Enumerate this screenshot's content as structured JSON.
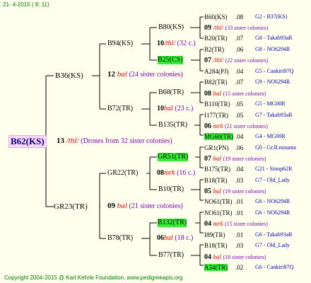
{
  "header": "21-  4-2015 (  8: 11)",
  "footer": "Copyright 2004-2015 @ Karl Kehrle Foundation.   www.pedigreeapis.org",
  "root": {
    "label": "B62(KS)",
    "num": "13",
    "mark": "/thl/",
    "note": "(Drones from 32 sister colonies)"
  },
  "gen1": [
    {
      "label": "B36(KS)"
    },
    {
      "label": "GR23(TR)"
    }
  ],
  "gen2": [
    {
      "label": "B94(KS)",
      "num": "12",
      "mark": "bal",
      "note": "(24 sister colonies)"
    },
    {
      "label": "B72(TR)"
    },
    {
      "label": "GR22(TR)",
      "num": "09",
      "mark": "bal",
      "note": "(21 sister colonies)"
    },
    {
      "label": "B78(TR)"
    }
  ],
  "gen3": [
    {
      "label": "B80(KS)",
      "num": "10",
      "mark": "/thl/",
      "note": "(32 c.)"
    },
    {
      "label": "B25(CS)"
    },
    {
      "label": "B68(TR)",
      "num": "10",
      "mark": "bal",
      "note": "(23 c.)"
    },
    {
      "label": "B135(TR)"
    },
    {
      "label": "GR51(TR)",
      "num": "08",
      "mark": "mrk",
      "note": "(16 c.)"
    },
    {
      "label": "B10(TR)"
    },
    {
      "label": "B132(TR)",
      "num": "06",
      "mark": "bal",
      "note": "(18 c.)"
    },
    {
      "label": "B77(TR)"
    }
  ],
  "gen4": [
    {
      "label": "B60(KS)",
      "yr": ".08",
      "tag": "G2 - B37(KS)"
    },
    {
      "num": "09",
      "mark": "/thl/",
      "note": "(33 sister colonies)"
    },
    {
      "label": "B20(TR)",
      "yr": ".07",
      "tag": "G8 - Takab93aR"
    },
    {
      "label": "B2(TR)",
      "yr": ".06",
      "tag": "G8 - NO6294R"
    },
    {
      "num": "07",
      "mark": "/thl/",
      "note": "(22 sister colonies)"
    },
    {
      "label": "A284(PJ)",
      "yr": ".04",
      "tag": "G5 - Cankiri97Q"
    },
    {
      "label": "B82(TR)",
      "yr": ".07",
      "tag": "G9 - NO6294R"
    },
    {
      "num": "08",
      "mark": "bal",
      "note": "(15 sister colonies)"
    },
    {
      "label": "B110(TR)",
      "yr": ".05",
      "tag": "G5 - MG00R"
    },
    {
      "label": "I177(TR)",
      "yr": ".05",
      "tag": "G7 - Takab93aR"
    },
    {
      "num": "06",
      "mark": "mrk",
      "note": "(21 sister colonies)"
    },
    {
      "label": "MG60(TR)",
      "yr": ".04",
      "tag": "G4 - MG00R"
    },
    {
      "label": "GR1(PN)",
      "yr": ".06",
      "tag": "G0 - Gr.R.mounta"
    },
    {
      "num": "07",
      "mark": "bal",
      "note": "(19 sister colonies)"
    },
    {
      "label": "B175(TR)",
      "yr": ".04",
      "tag": "G21 - Sinop62R"
    },
    {
      "label": "B18(TR)",
      "yr": ".03",
      "tag": "G7 - Old_Lady"
    },
    {
      "num": "05",
      "mark": "bal",
      "note": "(19 sister colonies)"
    },
    {
      "label": "NO61(TR)",
      "yr": ".01",
      "tag": "G6 - NO6294R"
    },
    {
      "label": "NO61(TR)",
      "yr": ".01",
      "tag": "G6 - NO6294R"
    },
    {
      "num": "04",
      "mark": "mrk",
      "note": "(15 sister colonies)"
    },
    {
      "label": "I89(TR)",
      "yr": ".01",
      "tag": "G6 - Takab93aR"
    },
    {
      "label": "B18(TR)",
      "yr": ".03",
      "tag": "G7 - Old_Lady"
    },
    {
      "num": "04",
      "mark": "bal",
      "note": "(18 sister colonies)"
    },
    {
      "label": "A34(TR)",
      "yr": ".02",
      "tag": "G6 - Cankiri97Q"
    }
  ],
  "colors": {
    "highlight": "#33ee33",
    "root_bg": "#ffd4ff",
    "tag": "#0000c0",
    "mark": "#ff0000",
    "note": "#8000c0"
  }
}
